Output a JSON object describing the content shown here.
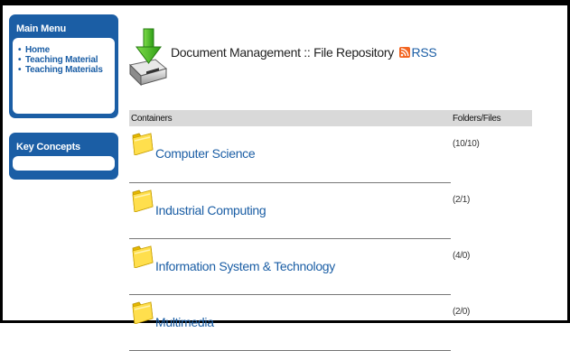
{
  "sidebar": {
    "main_menu": {
      "title": "Main Menu",
      "items": [
        {
          "label": "Home"
        },
        {
          "label": "Teaching Material"
        },
        {
          "label": "Teaching Materials"
        }
      ]
    },
    "key_concepts": {
      "title": "Key Concepts"
    }
  },
  "header": {
    "title": "Document Management :: File Repository",
    "rss_label": "RSS",
    "icon": "drive-download-icon",
    "rss_icon": "rss-icon"
  },
  "table": {
    "headers": [
      "Containers",
      "Folders/Files"
    ],
    "rows": [
      {
        "name": "Computer Science",
        "count": "(10/10)",
        "icon": "folder-icon"
      },
      {
        "name": "Industrial Computing",
        "count": "(2/1)",
        "icon": "folder-icon"
      },
      {
        "name": "Information System & Technology",
        "count": "(4/0)",
        "icon": "folder-icon"
      },
      {
        "name": "Multimedia",
        "count": "(2/0)",
        "icon": "folder-icon"
      }
    ]
  },
  "colors": {
    "accent": "#1b5ea5",
    "header_bg": "#d9d9d9",
    "rss": "#f26522",
    "download_arrow": "#3cb521"
  }
}
